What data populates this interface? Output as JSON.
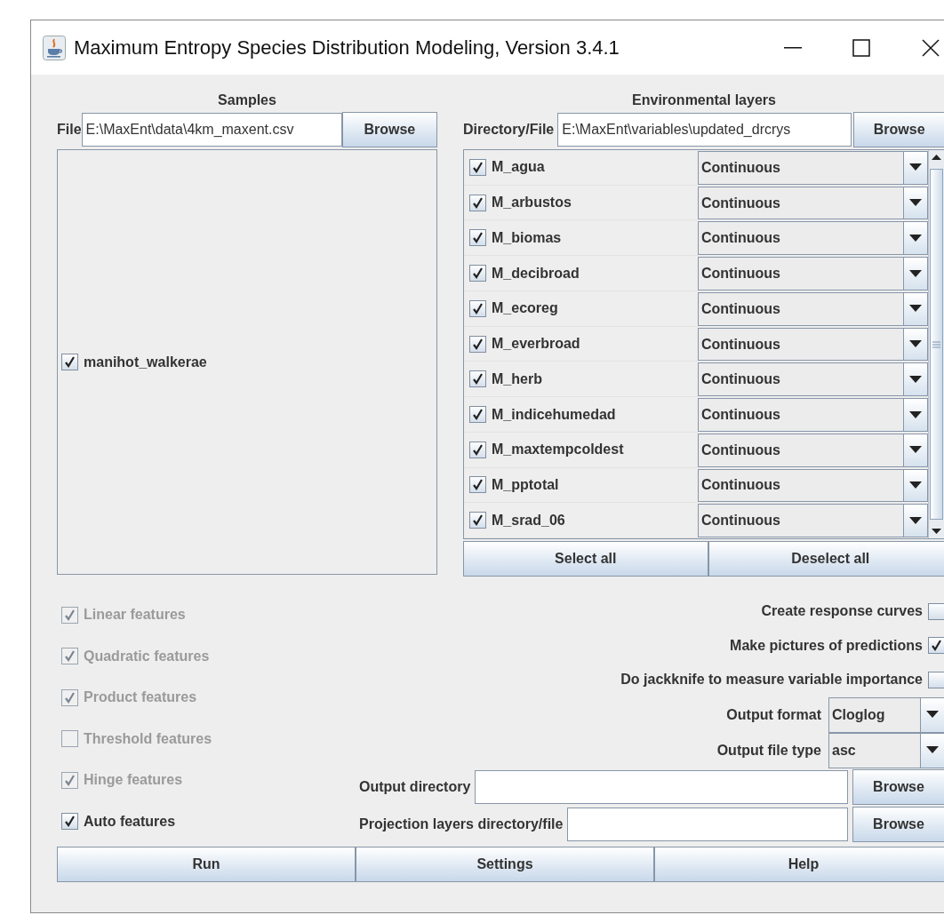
{
  "window": {
    "title": "Maximum Entropy Species Distribution Modeling, Version 3.4.1"
  },
  "samples": {
    "heading": "Samples",
    "file_label": "File",
    "file_value": "E:\\MaxEnt\\data\\4km_maxent.csv",
    "browse": "Browse",
    "species": [
      {
        "name": "manihot_walkerae",
        "checked": true
      }
    ]
  },
  "environmental_layers": {
    "heading": "Environmental layers",
    "dir_label": "Directory/File",
    "dir_value": "E:\\MaxEnt\\variables\\updated_drcrys",
    "browse": "Browse",
    "layers": [
      {
        "name": "M_agua",
        "checked": true,
        "type": "Continuous"
      },
      {
        "name": "M_arbustos",
        "checked": true,
        "type": "Continuous"
      },
      {
        "name": "M_biomas",
        "checked": true,
        "type": "Continuous"
      },
      {
        "name": "M_decibroad",
        "checked": true,
        "type": "Continuous"
      },
      {
        "name": "M_ecoreg",
        "checked": true,
        "type": "Continuous"
      },
      {
        "name": "M_everbroad",
        "checked": true,
        "type": "Continuous"
      },
      {
        "name": "M_herb",
        "checked": true,
        "type": "Continuous"
      },
      {
        "name": "M_indicehumedad",
        "checked": true,
        "type": "Continuous"
      },
      {
        "name": "M_maxtempcoldest",
        "checked": true,
        "type": "Continuous"
      },
      {
        "name": "M_pptotal",
        "checked": true,
        "type": "Continuous"
      },
      {
        "name": "M_srad_06",
        "checked": true,
        "type": "Continuous"
      }
    ],
    "select_all": "Select all",
    "deselect_all": "Deselect all"
  },
  "features": [
    {
      "label": "Linear features",
      "checked": true,
      "disabled": true
    },
    {
      "label": "Quadratic features",
      "checked": true,
      "disabled": true
    },
    {
      "label": "Product features",
      "checked": true,
      "disabled": true
    },
    {
      "label": "Threshold features",
      "checked": false,
      "disabled": true
    },
    {
      "label": "Hinge features",
      "checked": true,
      "disabled": true
    },
    {
      "label": "Auto features",
      "checked": true,
      "disabled": false
    }
  ],
  "options": [
    {
      "label": "Create response curves",
      "checked": false
    },
    {
      "label": "Make pictures of predictions",
      "checked": true
    },
    {
      "label": "Do jackknife to measure variable importance",
      "checked": false
    }
  ],
  "output_format": {
    "label": "Output format",
    "value": "Cloglog"
  },
  "output_file_type": {
    "label": "Output file type",
    "value": "asc"
  },
  "output_directory": {
    "label": "Output directory",
    "browse": "Browse"
  },
  "projection": {
    "label": "Projection layers directory/file",
    "browse": "Browse"
  },
  "buttons": [
    "Run",
    "Settings",
    "Help"
  ]
}
